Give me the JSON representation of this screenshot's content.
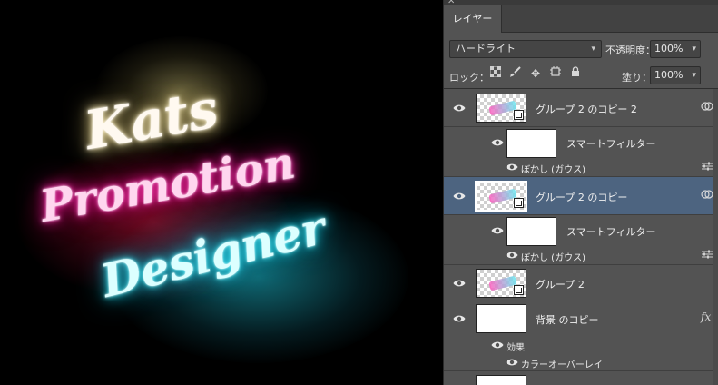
{
  "canvas": {
    "lines": [
      "Kats",
      "Promotion",
      "Designer"
    ]
  },
  "panel": {
    "tab_label": "レイヤー",
    "blend_mode": "ハードライト",
    "opacity_label": "不透明度：",
    "opacity_value": "100%",
    "lock_label": "ロック：",
    "fill_label": "塗り：",
    "fill_value": "100%"
  },
  "layers": [
    {
      "name": "グループ 2 のコピー 2",
      "thumbnail": "checker",
      "smart_object": true,
      "selected": false
    },
    {
      "sub": "スマートフィルター"
    },
    {
      "sub": "ぼかし (ガウス)"
    },
    {
      "name": "グループ 2 のコピー",
      "thumbnail": "checker",
      "smart_object": true,
      "selected": true
    },
    {
      "sub": "スマートフィルター"
    },
    {
      "sub": "ぼかし (ガウス)"
    },
    {
      "name": "グループ 2",
      "thumbnail": "checker",
      "smart_object": true,
      "selected": false
    },
    {
      "name": "背景 のコピー",
      "thumbnail": "white",
      "fx": "fx"
    },
    {
      "sub": "効果"
    },
    {
      "sub": "カラーオーバーレイ"
    }
  ],
  "icons": {
    "eye": "eye-icon",
    "lock_transparent": "checkerboard-lock-icon",
    "lock_paint": "brush-lock-icon",
    "lock_move": "move-lock-icon",
    "lock_artboard": "artboard-lock-icon",
    "lock_all": "padlock-icon",
    "smart_filter_link": "linked-circles-icon",
    "filter_options": "filter-options-icon"
  },
  "colors": {
    "panel_bg": "#535353",
    "selected_row": "#4d6480",
    "neon_white": "#fff3cc",
    "neon_pink": "#ff1fa8",
    "neon_cyan": "#19d8f0"
  }
}
